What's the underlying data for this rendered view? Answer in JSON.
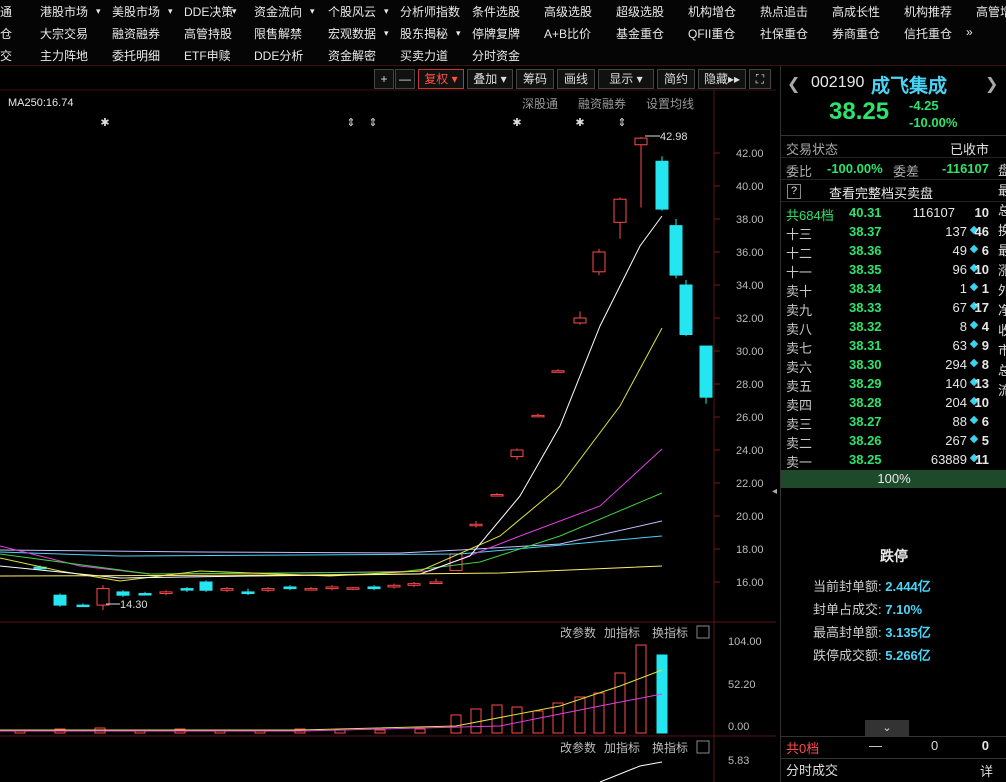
{
  "menu": {
    "row1": [
      "通",
      "港股市场",
      "美股市场",
      "DDE决策",
      "资金流向",
      "个股风云",
      "分析师指数",
      "条件选股",
      "高级选股",
      "超级选股",
      "机构增仓",
      "热点追击",
      "高成长性",
      "机构推荐",
      "高管增"
    ],
    "row2": [
      "仓",
      "大宗交易",
      "融资融券",
      "高管持股",
      "限售解禁",
      "宏观数据",
      "股东揭秘",
      "停牌复牌",
      "A+B比价",
      "基金重仓",
      "QFII重仓",
      "社保重仓",
      "券商重仓",
      "信托重仓",
      "»"
    ],
    "row3": [
      "交",
      "主力阵地",
      "委托明细",
      "ETF申赎",
      "DDE分析",
      "资金解密",
      "买卖力道",
      "分时资金"
    ]
  },
  "toolbar": {
    "plus": "+",
    "minus": "—",
    "fuquan": "复权",
    "diejia": "叠加",
    "chouma": "筹码",
    "huaxian": "画线",
    "xianshi": "显示",
    "jianyue": "简约",
    "yincang": "隐藏",
    "expand": "⛶"
  },
  "ma_label": "MA250:16.74",
  "top_links": [
    "深股通",
    "融资融券",
    "设置均线"
  ],
  "price_labels": {
    "high": "42.98",
    "low": "14.30"
  },
  "y_axis": [
    "42.00",
    "40.00",
    "38.00",
    "36.00",
    "34.00",
    "32.00",
    "30.00",
    "28.00",
    "26.00",
    "24.00",
    "22.00",
    "20.00",
    "18.00",
    "16.00"
  ],
  "vol_panel": {
    "links": [
      "改参数",
      "加指标",
      "换指标"
    ],
    "axis": [
      "104.00",
      "52.20",
      "0.00"
    ]
  },
  "ind_panel": {
    "links": [
      "改参数",
      "加指标",
      "换指标"
    ],
    "axis": [
      "5.83"
    ]
  },
  "stock": {
    "code": "002190",
    "name": "成飞集成",
    "price": "38.25",
    "change": "-4.25",
    "pct": "-10.00%"
  },
  "status": {
    "label": "交易状态",
    "value": "已收市"
  },
  "ratio": {
    "weibi_label": "委比",
    "weibi": "-100.00%",
    "weicha_label": "委差",
    "weicha": "-116107"
  },
  "full_book": {
    "icon": "?",
    "label": "查看完整档买卖盘"
  },
  "total": {
    "label": "共684档",
    "price": "40.31",
    "vol": "116107",
    "cnt": "10"
  },
  "asks": [
    {
      "name": "十三",
      "price": "38.37",
      "vol": "137",
      "cnt": "46"
    },
    {
      "name": "十二",
      "price": "38.36",
      "vol": "49",
      "cnt": "6"
    },
    {
      "name": "十一",
      "price": "38.35",
      "vol": "96",
      "cnt": "10"
    },
    {
      "name": "卖十",
      "price": "38.34",
      "vol": "1",
      "cnt": "1"
    },
    {
      "name": "卖九",
      "price": "38.33",
      "vol": "67",
      "cnt": "17"
    },
    {
      "name": "卖八",
      "price": "38.32",
      "vol": "8",
      "cnt": "4"
    },
    {
      "name": "卖七",
      "price": "38.31",
      "vol": "63",
      "cnt": "9"
    },
    {
      "name": "卖六",
      "price": "38.30",
      "vol": "294",
      "cnt": "8"
    },
    {
      "name": "卖五",
      "price": "38.29",
      "vol": "140",
      "cnt": "13"
    },
    {
      "name": "卖四",
      "price": "38.28",
      "vol": "204",
      "cnt": "10"
    },
    {
      "name": "卖三",
      "price": "38.27",
      "vol": "88",
      "cnt": "6"
    },
    {
      "name": "卖二",
      "price": "38.26",
      "vol": "267",
      "cnt": "5"
    },
    {
      "name": "卖一",
      "price": "38.25",
      "vol": "63889",
      "cnt": "11"
    }
  ],
  "bar_pct": "100%",
  "limit": {
    "title": "跌停",
    "items": [
      {
        "label": "当前封单额:",
        "value": "2.444亿"
      },
      {
        "label": "封单占成交:",
        "value": "7.10%"
      },
      {
        "label": "最高封单额:",
        "value": "3.135亿"
      },
      {
        "label": "跌停成交额:",
        "value": "5.266亿"
      }
    ]
  },
  "bid_total": {
    "label": "共0档",
    "dash": "—",
    "a": "0",
    "b": "0"
  },
  "footer": {
    "label": "分时成交",
    "detail": "详"
  },
  "side_chars": [
    "盘",
    "最",
    "总",
    "换",
    "最",
    "涨",
    "外",
    "净",
    "收",
    "市",
    "总",
    "流"
  ]
}
